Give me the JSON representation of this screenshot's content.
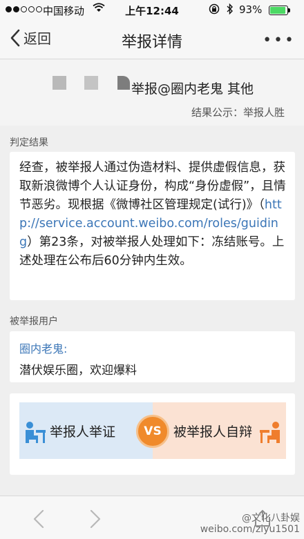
{
  "status_bar": {
    "carrier": "中国移动",
    "time": "上午12:44",
    "battery_pct": "93%",
    "battery_level": 0.93,
    "signal_bars": 2,
    "signal_total": 5
  },
  "nav": {
    "back_label": "返回",
    "title": "举报详情",
    "more_label": "•••"
  },
  "report": {
    "title": "举报@圈内老鬼 其他",
    "result_public": "结果公示：举报人胜"
  },
  "verdict": {
    "section_label": "判定结果",
    "text_before_link": "经查，被举报人通过伪造材料、提供虚假信息，获取新浪微博个人认证身份，构成“身份虚假”，且情节恶劣。现根据《微博社区管理规定(试行)》（",
    "link": "http://service.account.weibo.com/roles/guiding",
    "text_after_link": "）第23条，对被举报人处理如下：冻结账号。上述处理在公布后60分钟内生效。"
  },
  "reported_user": {
    "section_label": "被举报用户",
    "name": "圈内老鬼:",
    "description": "潜伏娱乐圈，欢迎爆料"
  },
  "versus": {
    "left_label": "举报人举证",
    "vs_label": "VS",
    "right_label": "被举报人自辩",
    "left_color": "#dce9f6",
    "right_color": "#fbe2d3",
    "badge_color": "#f08a2b"
  },
  "watermark": {
    "line1": "@文化八卦娱",
    "line2": "weibo.com/ziyu1501"
  },
  "icons": [
    "wifi-icon",
    "lock-rotation-icon",
    "bluetooth-icon",
    "battery-icon",
    "back-chevron-icon",
    "more-icon",
    "person-desk-icon",
    "toolbar-back-icon",
    "toolbar-forward-icon",
    "share-icon"
  ]
}
